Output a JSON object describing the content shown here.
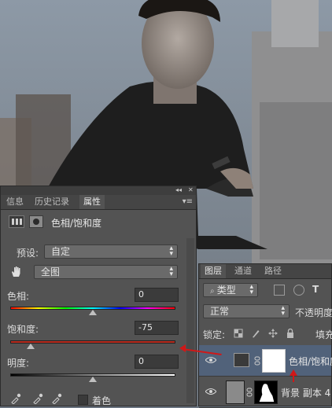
{
  "properties_panel": {
    "tabs": [
      "信息",
      "历史记录",
      "属性"
    ],
    "active_tab": "属性",
    "collapse_glyph": "◂◂",
    "close_glyph": "✕",
    "title": "色相/饱和度",
    "preset_label": "预设:",
    "preset_value": "自定",
    "channel_value": "全图",
    "hue_label": "色相:",
    "hue_value": "0",
    "saturation_label": "饱和度:",
    "saturation_value": "-75",
    "lightness_label": "明度:",
    "lightness_value": "0",
    "colorize_label": "着色",
    "colorize_checked": false,
    "hue_level": 0.5,
    "saturation_level": 0.125,
    "lightness_level": 0.5
  },
  "layers_panel": {
    "tabs": [
      "图层",
      "通道",
      "路径"
    ],
    "active_tab": "图层",
    "filter_value": "类型",
    "blend_mode": "正常",
    "opacity_label": "不透明度",
    "lock_label": "锁定:",
    "fill_label": "填充",
    "layers": [
      {
        "name": "色相/饱和度",
        "selected": true,
        "type": "adjustment"
      },
      {
        "name": "背景 副本 4",
        "selected": false,
        "type": "raster"
      }
    ]
  },
  "colors": {
    "panel_bg": "#535353",
    "selected_layer": "#51627a",
    "annotation_red": "#d01818"
  },
  "icons": [
    "adjustment-layer-icon",
    "mask-icon",
    "hand-tool-icon",
    "eyedropper-icon",
    "eye-icon",
    "link-icon",
    "lock-icon"
  ]
}
